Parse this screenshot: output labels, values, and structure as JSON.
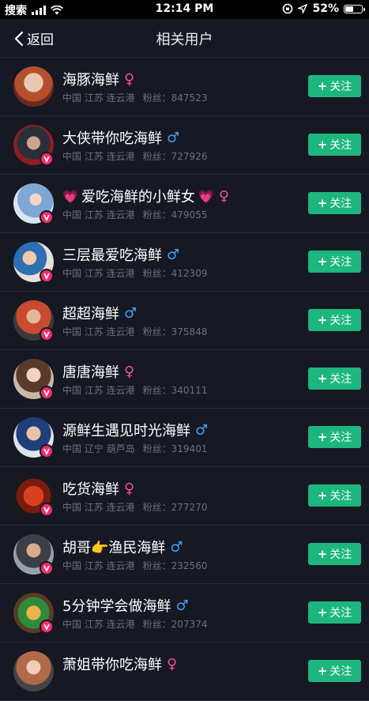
{
  "status_bar": {
    "back_app": "搜索",
    "time": "12:14 PM",
    "battery": "52%",
    "battery_level": 0.52
  },
  "nav": {
    "back_label": "返回",
    "title": "相关用户"
  },
  "colors": {
    "background": "#161823",
    "follow_button": "#1db67e",
    "verified_badge": "#f72b6a",
    "female": "#f7508f",
    "male": "#3fa2ff"
  },
  "users": [
    {
      "name": "海豚海鲜",
      "gender": "♀",
      "gender_icon": "female-icon",
      "location": "中国 江苏 连云港",
      "fans_label": "粉丝：",
      "fans": "847523",
      "follow_label": "关注",
      "verified": false
    },
    {
      "name": "大侠带你吃海鲜",
      "gender": "♂",
      "gender_icon": "male-icon",
      "location": "中国 江苏 连云港",
      "fans_label": "粉丝：",
      "fans": "727926",
      "follow_label": "关注",
      "verified": true
    },
    {
      "name": "爱吃海鲜的小鲜女",
      "gender": "♀",
      "gender_icon": "female-icon",
      "location": "中国 江苏 连云港",
      "fans_label": "粉丝：",
      "fans": "479055",
      "follow_label": "关注",
      "verified": true,
      "hearts": true
    },
    {
      "name": "三层最爱吃海鲜",
      "gender": "♂",
      "gender_icon": "male-icon",
      "location": "中国 江苏 连云港",
      "fans_label": "粉丝：",
      "fans": "412309",
      "follow_label": "关注",
      "verified": true
    },
    {
      "name": "超超海鲜",
      "gender": "♂",
      "gender_icon": "male-icon",
      "location": "中国 江苏 连云港",
      "fans_label": "粉丝：",
      "fans": "375848",
      "follow_label": "关注",
      "verified": true
    },
    {
      "name": "唐唐海鲜",
      "gender": "♀",
      "gender_icon": "female-icon",
      "location": "中国 江苏 连云港",
      "fans_label": "粉丝：",
      "fans": "340111",
      "follow_label": "关注",
      "verified": true
    },
    {
      "name": "源鲜生遇见时光海鲜",
      "gender": "♂",
      "gender_icon": "male-icon",
      "location": "中国 辽宁 葫芦岛",
      "fans_label": "粉丝：",
      "fans": "319401",
      "follow_label": "关注",
      "verified": true
    },
    {
      "name": "吃货海鲜",
      "gender": "♀",
      "gender_icon": "female-icon",
      "location": "中国 江苏 连云港",
      "fans_label": "粉丝：",
      "fans": "277270",
      "follow_label": "关注",
      "verified": true
    },
    {
      "name": "胡哥👉渔民海鲜",
      "gender": "♂",
      "gender_icon": "male-icon",
      "location": "中国 江苏 连云港",
      "fans_label": "粉丝：",
      "fans": "232560",
      "follow_label": "关注",
      "verified": true
    },
    {
      "name": "5分钟学会做海鲜",
      "gender": "♂",
      "gender_icon": "male-icon",
      "location": "中国 江苏 连云港",
      "fans_label": "粉丝：",
      "fans": "207374",
      "follow_label": "关注",
      "verified": true
    },
    {
      "name": "萧姐带你吃海鲜",
      "gender": "♀",
      "gender_icon": "female-icon",
      "location": "",
      "fans_label": "",
      "fans": "",
      "follow_label": "关注",
      "verified": false
    }
  ]
}
